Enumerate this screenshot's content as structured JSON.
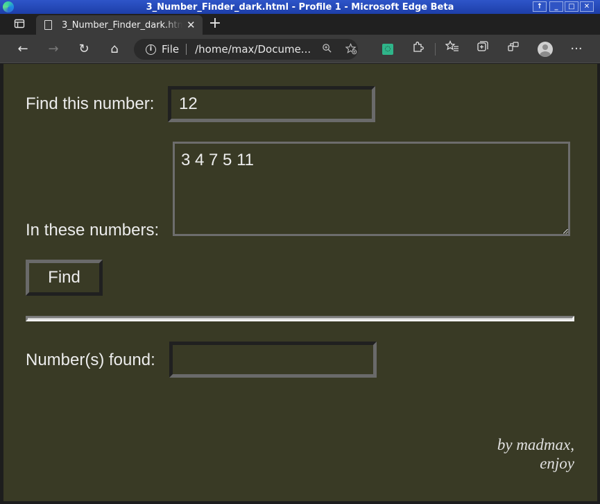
{
  "window": {
    "title": "3_Number_Finder_dark.html - Profile 1 - Microsoft Edge Beta",
    "controls": {
      "pin": "↑",
      "minimize": "_",
      "maximize": "□",
      "close": "✕"
    }
  },
  "tabs": [
    {
      "title": "3_Number_Finder_dark.html",
      "close": "✕"
    }
  ],
  "new_tab": "+",
  "nav": {
    "back": "←",
    "forward": "→",
    "refresh": "↻",
    "home": "⌂",
    "address": {
      "info": "i",
      "scheme_label": "File",
      "url": "/home/max/Docume..."
    },
    "more": "···"
  },
  "icons": [
    "sidebar-icon",
    "document-icon",
    "info-icon",
    "zoom-icon",
    "add-favorite-icon",
    "extension-green-icon",
    "puzzle-icon",
    "favorites-icon",
    "collections-icon",
    "performance-icon",
    "profile-icon",
    "more-icon"
  ],
  "form": {
    "find_label": "Find this number:",
    "find_value": "12",
    "numbers_label": "In these numbers:",
    "numbers_value": "3 4 7 5 11",
    "find_button": "Find",
    "found_label": "Number(s) found:",
    "found_value": ""
  },
  "credit": {
    "line1": "by madmax,",
    "line2": "enjoy"
  },
  "colors": {
    "page_background": "#393a25",
    "text": "#ececec",
    "titlebar": "#2749b8"
  }
}
